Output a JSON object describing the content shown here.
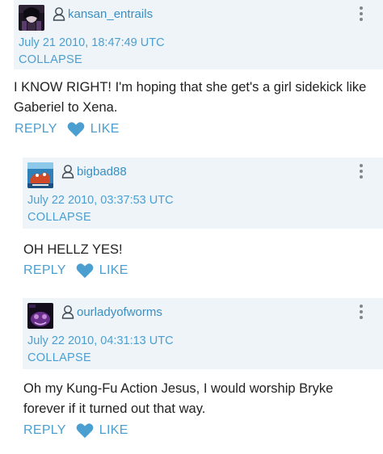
{
  "comments": [
    {
      "username": "kansan_entrails",
      "timestamp": "July 21 2010, 18:47:49 UTC",
      "collapse_label": "COLLAPSE",
      "body": "I KNOW RIGHT! I'm hoping that she get's a girl sidekick like Gaberiel to Xena.",
      "reply_label": "REPLY",
      "like_label": "LIKE"
    },
    {
      "username": "bigbad88",
      "timestamp": "July 22 2010, 03:37:53 UTC",
      "collapse_label": "COLLAPSE",
      "body": "OH HELLZ YES!",
      "reply_label": "REPLY",
      "like_label": "LIKE"
    },
    {
      "username": "ourladyofworms",
      "timestamp": "July 22 2010, 04:31:13 UTC",
      "collapse_label": "COLLAPSE",
      "body": "Oh my Kung-Fu Action Jesus, I would worship Bryke forever if it turned out that way.",
      "reply_label": "REPLY",
      "like_label": "LIKE"
    }
  ],
  "colors": {
    "accent": "#4a9fd0",
    "header_bg": "#eef4f8",
    "text": "#222222",
    "kebab": "#7d8790"
  },
  "icons": {
    "user": "user-icon",
    "heart": "heart-icon",
    "menu": "kebab-menu-icon"
  }
}
